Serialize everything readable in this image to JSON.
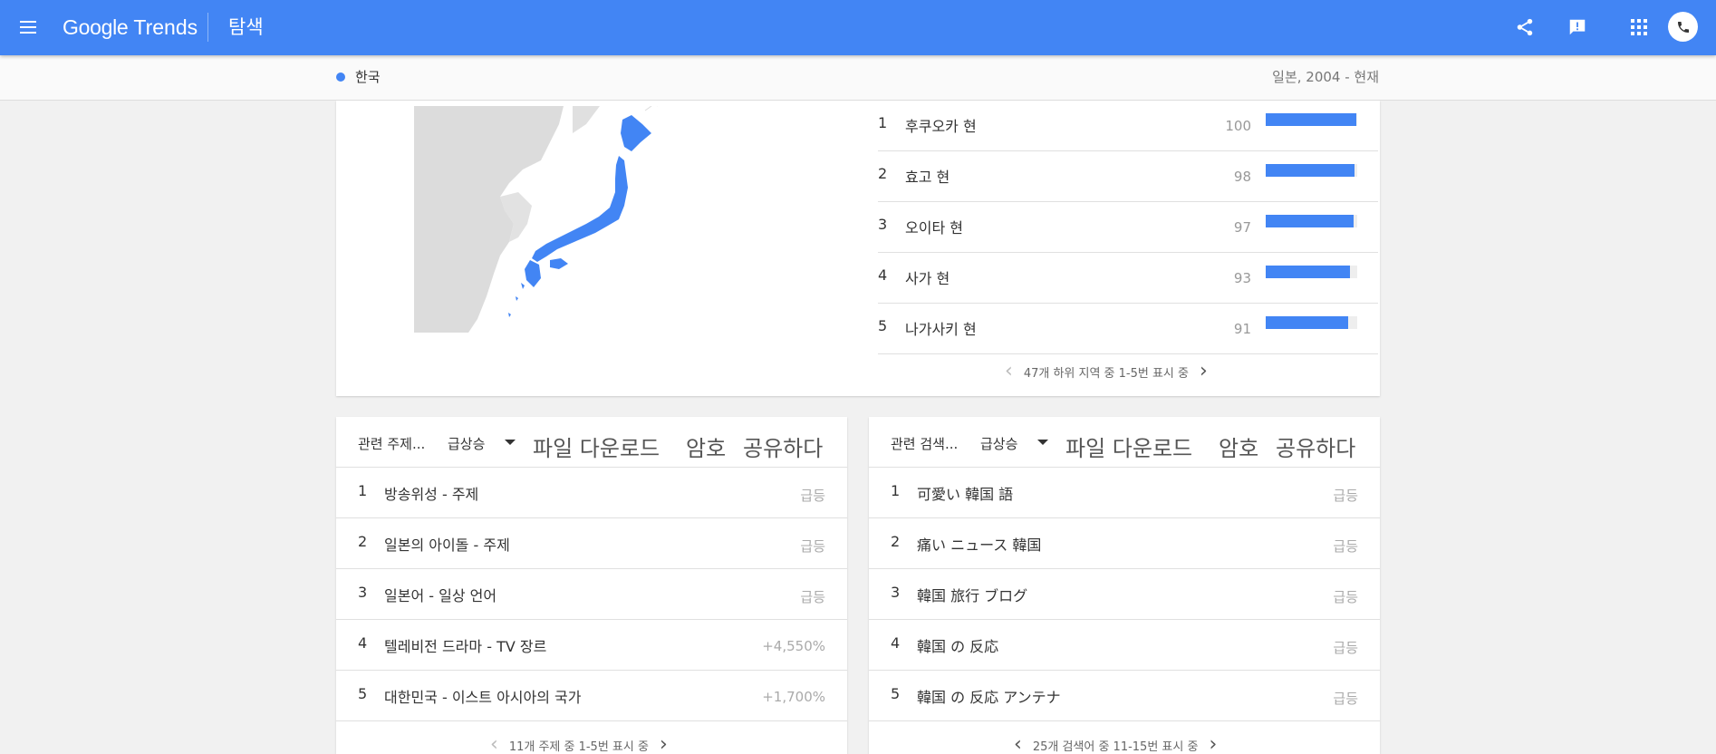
{
  "header": {
    "logo_google": "Google",
    "logo_trends": "Trends",
    "title": "탐색",
    "brand_color": "#4285f4"
  },
  "subheader": {
    "term": "한국",
    "scope": "일본, 2004 - 현재"
  },
  "regions": {
    "items": [
      {
        "rank": "1",
        "name": "후쿠오카 현",
        "value": "100"
      },
      {
        "rank": "2",
        "name": "효고 현",
        "value": "98"
      },
      {
        "rank": "3",
        "name": "오이타 현",
        "value": "97"
      },
      {
        "rank": "4",
        "name": "사가 현",
        "value": "93"
      },
      {
        "rank": "5",
        "name": "나가사키 현",
        "value": "91"
      }
    ],
    "pager": "47개 하위 지역 중 1-5번 표시 중"
  },
  "related_topics": {
    "title": "관련 주제...",
    "filter": "급상승",
    "actions": {
      "download": "파일 다운로드",
      "embed": "암호",
      "share": "공유하다"
    },
    "items": [
      {
        "rank": "1",
        "name": "방송위성 - 주제",
        "value": "급등"
      },
      {
        "rank": "2",
        "name": "일본의 아이돌 - 주제",
        "value": "급등"
      },
      {
        "rank": "3",
        "name": "일본어 - 일상 언어",
        "value": "급등"
      },
      {
        "rank": "4",
        "name": "텔레비전 드라마 - TV 장르",
        "value": "+4,550%"
      },
      {
        "rank": "5",
        "name": "대한민국 - 이스트 아시아의 국가",
        "value": "+1,700%"
      }
    ],
    "pager": "11개 주제 중 1-5번 표시 중"
  },
  "related_queries": {
    "title": "관련 검색...",
    "filter": "급상승",
    "actions": {
      "download": "파일 다운로드",
      "embed": "암호",
      "share": "공유하다"
    },
    "items": [
      {
        "rank": "1",
        "name": "可愛い 韓国 語",
        "value": "급등"
      },
      {
        "rank": "2",
        "name": "痛い ニュース 韓国",
        "value": "급등"
      },
      {
        "rank": "3",
        "name": "韓国 旅行 ブログ",
        "value": "급등"
      },
      {
        "rank": "4",
        "name": "韓国 の 反応",
        "value": "급등"
      },
      {
        "rank": "5",
        "name": "韓国 の 反応 アンテナ",
        "value": "급등"
      }
    ],
    "pager": "25개 검색어 중 11-15번 표시 중"
  }
}
